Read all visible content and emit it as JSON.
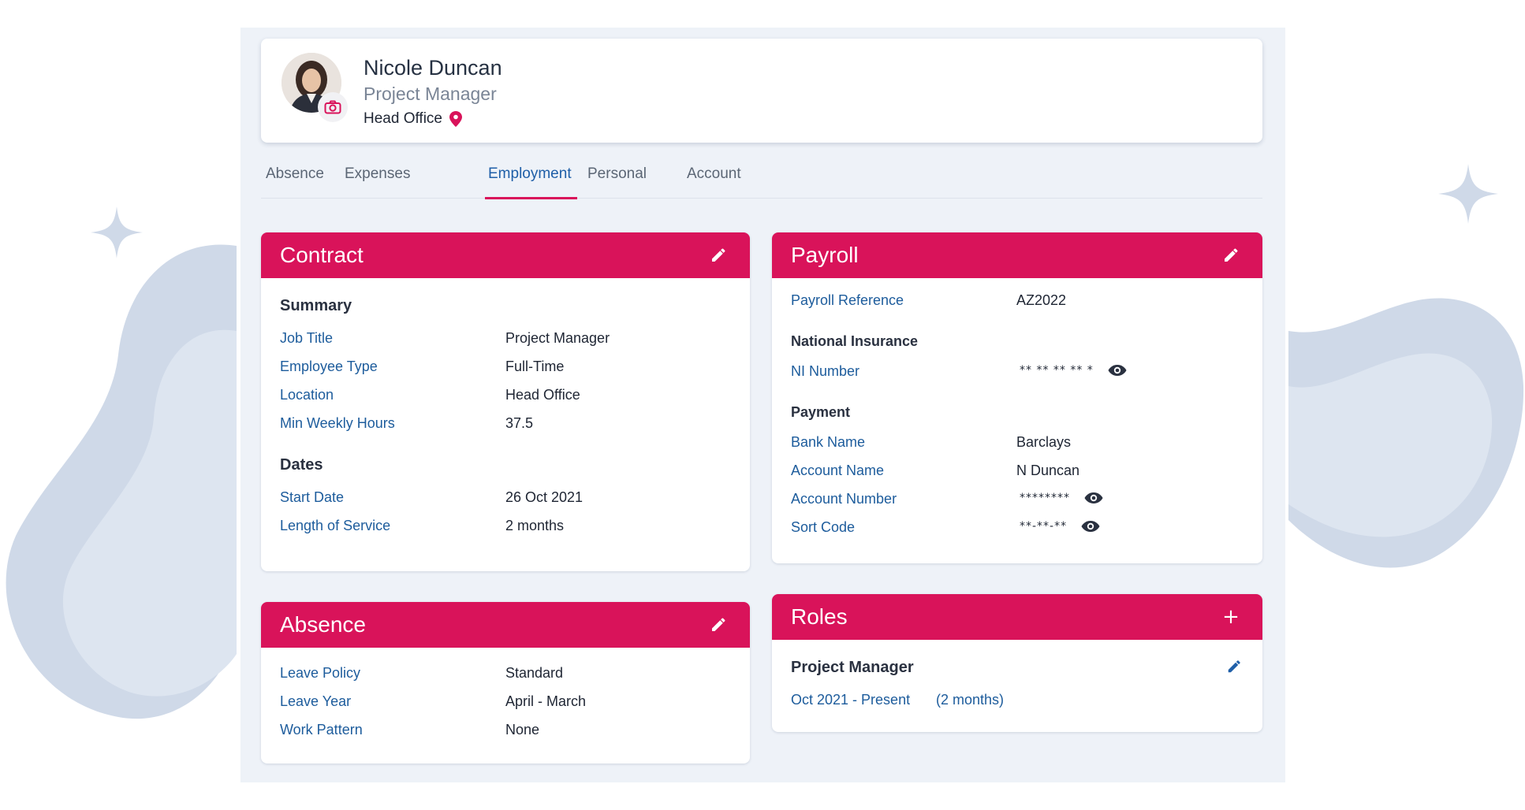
{
  "profile": {
    "name": "Nicole Duncan",
    "job_title": "Project Manager",
    "office": "Head Office"
  },
  "tabs": [
    {
      "label": "Absence"
    },
    {
      "label": "Expenses"
    },
    {
      "label": "Employment"
    },
    {
      "label": "Personal"
    },
    {
      "label": "Account"
    }
  ],
  "active_tab": "Employment",
  "contract": {
    "title": "Contract",
    "summary_heading": "Summary",
    "summary": [
      {
        "label": "Job Title",
        "value": "Project Manager"
      },
      {
        "label": "Employee Type",
        "value": "Full-Time"
      },
      {
        "label": "Location",
        "value": "Head Office"
      },
      {
        "label": "Min Weekly Hours",
        "value": "37.5"
      }
    ],
    "dates_heading": "Dates",
    "dates": [
      {
        "label": "Start Date",
        "value": "26 Oct 2021"
      },
      {
        "label": "Length of Service",
        "value": "2 months"
      }
    ]
  },
  "payroll": {
    "title": "Payroll",
    "reference_label": "Payroll Reference",
    "reference_value": "AZ2022",
    "ni_heading": "National Insurance",
    "ni_label": "NI Number",
    "ni_value": "** ** ** ** *",
    "payment_heading": "Payment",
    "payment": [
      {
        "label": "Bank Name",
        "value": "Barclays"
      },
      {
        "label": "Account Name",
        "value": "N Duncan"
      },
      {
        "label": "Account Number",
        "value": "********"
      },
      {
        "label": "Sort Code",
        "value": "**-**-**"
      }
    ]
  },
  "absence": {
    "title": "Absence",
    "rows": [
      {
        "label": "Leave Policy",
        "value": "Standard"
      },
      {
        "label": "Leave Year",
        "value": "April - March"
      },
      {
        "label": "Work Pattern",
        "value": "None"
      }
    ]
  },
  "roles": {
    "title": "Roles",
    "add_symbol": "+",
    "items": [
      {
        "name": "Project Manager",
        "period": "Oct 2021 - Present",
        "duration": "(2 months)"
      }
    ]
  },
  "colors": {
    "accent": "#d9135a",
    "label_blue": "#1d5c9c",
    "tab_active": "#1f5fa8",
    "panel_bg": "#eef2f8",
    "blob": "#cfd9e8"
  },
  "icons": [
    "camera-icon",
    "location-pin-icon",
    "edit-pencil-icon",
    "eye-icon",
    "plus-icon",
    "sparkle-icon"
  ]
}
